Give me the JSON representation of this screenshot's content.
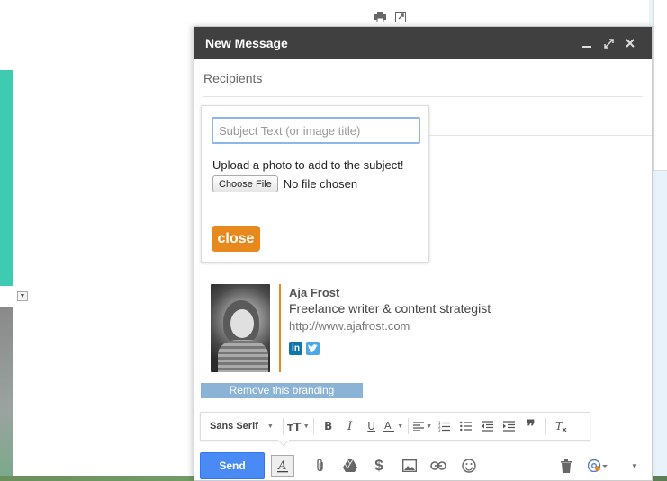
{
  "compose": {
    "title": "New Message",
    "recipients_placeholder": "Recipients"
  },
  "popup": {
    "subject_placeholder": "Subject Text (or image title)",
    "upload_text": "Upload a photo to add to the subject!",
    "choose_file": "Choose File",
    "no_file": "No file chosen",
    "close": "close"
  },
  "signature": {
    "name": "Aja Frost",
    "role": "Freelance writer & content strategist",
    "url": "http://www.ajafrost.com"
  },
  "branding": "Remove this branding",
  "format_toolbar": {
    "font": "Sans Serif"
  },
  "send": "Send",
  "colors": {
    "accent_orange": "#e8891e",
    "send_blue": "#4a8af4",
    "header_dark": "#404040",
    "teal": "#3ecbb2"
  }
}
